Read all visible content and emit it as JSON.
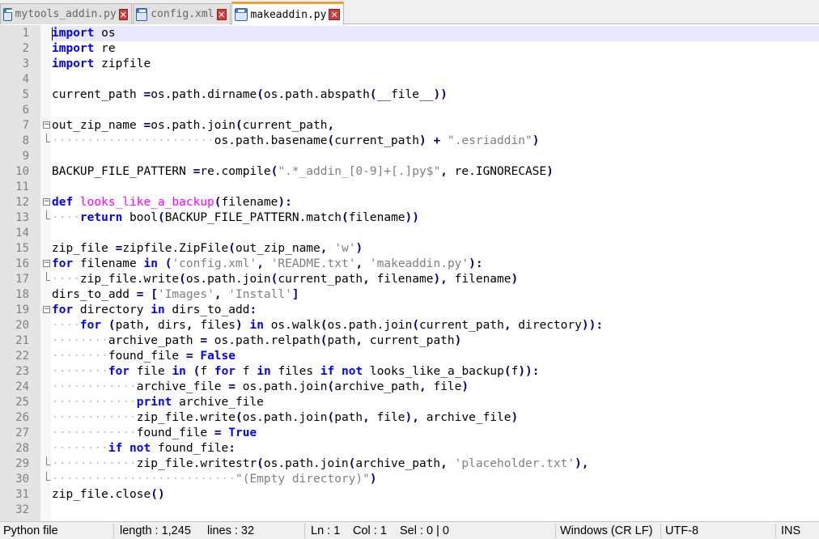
{
  "tabs": [
    {
      "label": "mytools_addin.py",
      "active": false
    },
    {
      "label": "config.xml",
      "active": false
    },
    {
      "label": "makeaddin.py",
      "active": true
    }
  ],
  "icons": {
    "file": "save-disk-icon",
    "close": "close-x-icon"
  },
  "colors": {
    "keyword": "#0000ff",
    "operator": "#000080",
    "string": "#808080",
    "function_def": "#ff00ff",
    "current_line": "#e8e8ff"
  },
  "editor": {
    "current_line": 1,
    "lines": [
      [
        [
          "kw",
          "import"
        ],
        [
          "",
          "os"
        ]
      ],
      [
        [
          "kw",
          "import"
        ],
        [
          "",
          "re"
        ]
      ],
      [
        [
          "kw",
          "import"
        ],
        [
          "",
          "zipfile"
        ]
      ],
      [],
      [
        [
          "",
          "current_path "
        ],
        [
          "op",
          "="
        ],
        [
          "",
          "os.path.dirname"
        ],
        [
          "op",
          "("
        ],
        [
          "",
          "os.path.abspath"
        ],
        [
          "op",
          "("
        ],
        [
          "",
          "__file__"
        ],
        [
          "op",
          "))"
        ]
      ],
      [],
      [
        [
          "",
          "out_zip_name "
        ],
        [
          "op",
          "="
        ],
        [
          "",
          "os.path.join"
        ],
        [
          "op",
          "("
        ],
        [
          "",
          "current_path"
        ],
        [
          "op",
          ","
        ]
      ],
      [
        [
          "dot",
          "·······················"
        ],
        [
          "",
          "os.path.basename"
        ],
        [
          "op",
          "("
        ],
        [
          "",
          "current_path"
        ],
        [
          "op",
          ")"
        ],
        [
          "",
          " "
        ],
        [
          "op",
          "+"
        ],
        [
          "",
          " "
        ],
        [
          "str",
          "\".esriaddin\""
        ],
        [
          "op",
          ")"
        ]
      ],
      [],
      [
        [
          "",
          "BACKUP_FILE_PATTERN "
        ],
        [
          "op",
          "="
        ],
        [
          "",
          "re.compile"
        ],
        [
          "op",
          "("
        ],
        [
          "str",
          "\".*_addin_[0-9]+[.]py$\""
        ],
        [
          "op",
          ","
        ],
        [
          "",
          " re.IGNORECASE"
        ],
        [
          "op",
          ")"
        ]
      ],
      [],
      [
        [
          "kw",
          "def"
        ],
        [
          "fn",
          "looks_like_a_backup"
        ],
        [
          "op",
          "("
        ],
        [
          "",
          "filename"
        ],
        [
          "op",
          "):"
        ]
      ],
      [
        [
          "dot",
          "····"
        ],
        [
          "kw",
          "return"
        ],
        [
          "",
          " bool"
        ],
        [
          "op",
          "("
        ],
        [
          "",
          "BACKUP_FILE_PATTERN.match"
        ],
        [
          "op",
          "("
        ],
        [
          "",
          "filename"
        ],
        [
          "op",
          "))"
        ]
      ],
      [],
      [
        [
          "",
          "zip_file "
        ],
        [
          "op",
          "="
        ],
        [
          "",
          "zipfile.ZipFile"
        ],
        [
          "op",
          "("
        ],
        [
          "",
          "out_zip_name"
        ],
        [
          "op",
          ","
        ],
        [
          "",
          " "
        ],
        [
          "str",
          "'w'"
        ],
        [
          "op",
          ")"
        ]
      ],
      [
        [
          "kw",
          "for"
        ],
        [
          "",
          " filename "
        ],
        [
          "kw",
          "in"
        ],
        [
          "",
          " "
        ],
        [
          "op",
          "("
        ],
        [
          "str",
          "'config.xml'"
        ],
        [
          "op",
          ","
        ],
        [
          "",
          " "
        ],
        [
          "str",
          "'README.txt'"
        ],
        [
          "op",
          ","
        ],
        [
          "",
          " "
        ],
        [
          "str",
          "'makeaddin.py'"
        ],
        [
          "op",
          "):"
        ]
      ],
      [
        [
          "dot",
          "····"
        ],
        [
          "",
          "zip_file.write"
        ],
        [
          "op",
          "("
        ],
        [
          "",
          "os.path.join"
        ],
        [
          "op",
          "("
        ],
        [
          "",
          "current_path"
        ],
        [
          "op",
          ","
        ],
        [
          "",
          " filename"
        ],
        [
          "op",
          "),"
        ],
        [
          "",
          " filename"
        ],
        [
          "op",
          ")"
        ]
      ],
      [
        [
          "",
          "dirs_to_add "
        ],
        [
          "op",
          "="
        ],
        [
          "",
          " "
        ],
        [
          "op",
          "["
        ],
        [
          "str",
          "'Images'"
        ],
        [
          "op",
          ","
        ],
        [
          "",
          " "
        ],
        [
          "str",
          "'Install'"
        ],
        [
          "op",
          "]"
        ]
      ],
      [
        [
          "kw",
          "for"
        ],
        [
          "",
          " directory "
        ],
        [
          "kw",
          "in"
        ],
        [
          "",
          " dirs_to_add"
        ],
        [
          "op",
          ":"
        ]
      ],
      [
        [
          "dot",
          "····"
        ],
        [
          "kw",
          "for"
        ],
        [
          "",
          " "
        ],
        [
          "op",
          "("
        ],
        [
          "",
          "path"
        ],
        [
          "op",
          ","
        ],
        [
          "",
          " dirs"
        ],
        [
          "op",
          ","
        ],
        [
          "",
          " files"
        ],
        [
          "op",
          ")"
        ],
        [
          "",
          " "
        ],
        [
          "kw",
          "in"
        ],
        [
          "",
          " os.walk"
        ],
        [
          "op",
          "("
        ],
        [
          "",
          "os.path.join"
        ],
        [
          "op",
          "("
        ],
        [
          "",
          "current_path"
        ],
        [
          "op",
          ","
        ],
        [
          "",
          " directory"
        ],
        [
          "op",
          "))"
        ],
        [
          "op",
          ":"
        ]
      ],
      [
        [
          "dot",
          "········"
        ],
        [
          "",
          "archive_path "
        ],
        [
          "op",
          "="
        ],
        [
          "",
          " os.path.relpath"
        ],
        [
          "op",
          "("
        ],
        [
          "",
          "path"
        ],
        [
          "op",
          ","
        ],
        [
          "",
          " current_path"
        ],
        [
          "op",
          ")"
        ]
      ],
      [
        [
          "dot",
          "········"
        ],
        [
          "",
          "found_file "
        ],
        [
          "op",
          "="
        ],
        [
          "",
          " "
        ],
        [
          "kw",
          "False"
        ]
      ],
      [
        [
          "dot",
          "········"
        ],
        [
          "kw",
          "for"
        ],
        [
          "",
          " file "
        ],
        [
          "kw",
          "in"
        ],
        [
          "",
          " "
        ],
        [
          "op",
          "("
        ],
        [
          "",
          "f "
        ],
        [
          "kw",
          "for"
        ],
        [
          "",
          " f "
        ],
        [
          "kw",
          "in"
        ],
        [
          "",
          " files "
        ],
        [
          "kw",
          "if"
        ],
        [
          "",
          " "
        ],
        [
          "kw",
          "not"
        ],
        [
          "",
          " looks_like_a_backup"
        ],
        [
          "op",
          "("
        ],
        [
          "",
          "f"
        ],
        [
          "op",
          "))"
        ],
        [
          "op",
          ":"
        ]
      ],
      [
        [
          "dot",
          "············"
        ],
        [
          "",
          "archive_file "
        ],
        [
          "op",
          "="
        ],
        [
          "",
          " os.path.join"
        ],
        [
          "op",
          "("
        ],
        [
          "",
          "archive_path"
        ],
        [
          "op",
          ","
        ],
        [
          "",
          " file"
        ],
        [
          "op",
          ")"
        ]
      ],
      [
        [
          "dot",
          "············"
        ],
        [
          "kw",
          "print"
        ],
        [
          "",
          " archive_file"
        ]
      ],
      [
        [
          "dot",
          "············"
        ],
        [
          "",
          "zip_file.write"
        ],
        [
          "op",
          "("
        ],
        [
          "",
          "os.path.join"
        ],
        [
          "op",
          "("
        ],
        [
          "",
          "path"
        ],
        [
          "op",
          ","
        ],
        [
          "",
          " file"
        ],
        [
          "op",
          "),"
        ],
        [
          "",
          " archive_file"
        ],
        [
          "op",
          ")"
        ]
      ],
      [
        [
          "dot",
          "············"
        ],
        [
          "",
          "found_file "
        ],
        [
          "op",
          "="
        ],
        [
          "",
          " "
        ],
        [
          "kw",
          "True"
        ]
      ],
      [
        [
          "dot",
          "········"
        ],
        [
          "kw",
          "if"
        ],
        [
          "",
          " "
        ],
        [
          "kw",
          "not"
        ],
        [
          "",
          " found_file"
        ],
        [
          "op",
          ":"
        ]
      ],
      [
        [
          "dot",
          "············"
        ],
        [
          "",
          "zip_file.writestr"
        ],
        [
          "op",
          "("
        ],
        [
          "",
          "os.path.join"
        ],
        [
          "op",
          "("
        ],
        [
          "",
          "archive_path"
        ],
        [
          "op",
          ","
        ],
        [
          "",
          " "
        ],
        [
          "str",
          "'placeholder.txt'"
        ],
        [
          "op",
          "),"
        ]
      ],
      [
        [
          "dot",
          "··························"
        ],
        [
          "str",
          "\"(Empty directory)\""
        ],
        [
          "op",
          ")"
        ]
      ],
      [
        [
          "",
          "zip_file.close"
        ],
        [
          "op",
          "()"
        ]
      ],
      []
    ],
    "folds": {
      "start": [
        7,
        12,
        16,
        19
      ],
      "end": [
        8,
        13,
        17,
        29,
        30
      ]
    }
  },
  "status": {
    "language": "Python file",
    "length": "length : 1,245",
    "lines": "lines : 32",
    "ln": "Ln : 1",
    "col": "Col : 1",
    "sel": "Sel : 0 | 0",
    "eol": "Windows (CR LF)",
    "encoding": "UTF-8",
    "mode": "INS"
  }
}
